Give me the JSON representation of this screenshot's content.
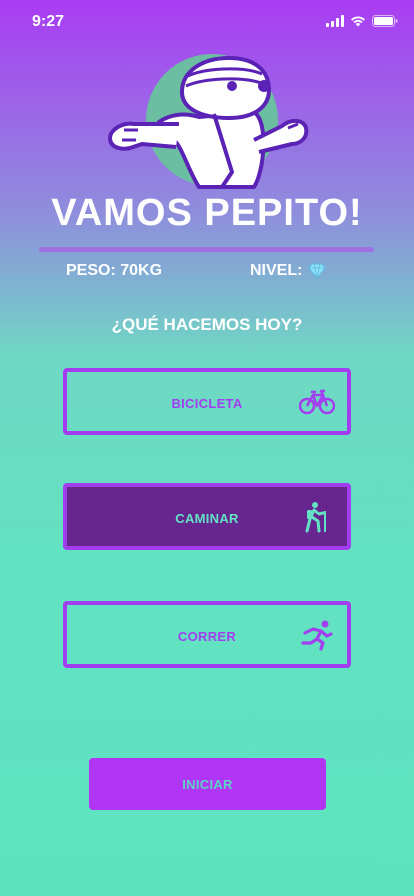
{
  "status_bar": {
    "time": "9:27"
  },
  "header": {
    "title": "VAMOS PEPITO!"
  },
  "stats": {
    "weight": "PESO: 70KG",
    "level_label": "NIVEL:",
    "level_icon": "diamond-icon"
  },
  "prompt": "¿QUÉ HACEMOS HOY?",
  "options": [
    {
      "label": "BICICLETA",
      "icon": "bicycle-icon",
      "selected": false
    },
    {
      "label": "CAMINAR",
      "icon": "hiking-icon",
      "selected": true
    },
    {
      "label": "CORRER",
      "icon": "running-icon",
      "selected": false
    }
  ],
  "start_button": {
    "label": "INICIAR"
  },
  "colors": {
    "accent_purple": "#a33df0",
    "selected_bg": "#67258f",
    "teal": "#63e3c3",
    "gradient_top": "#a93cf3",
    "gradient_bottom": "#5fe3bf"
  }
}
